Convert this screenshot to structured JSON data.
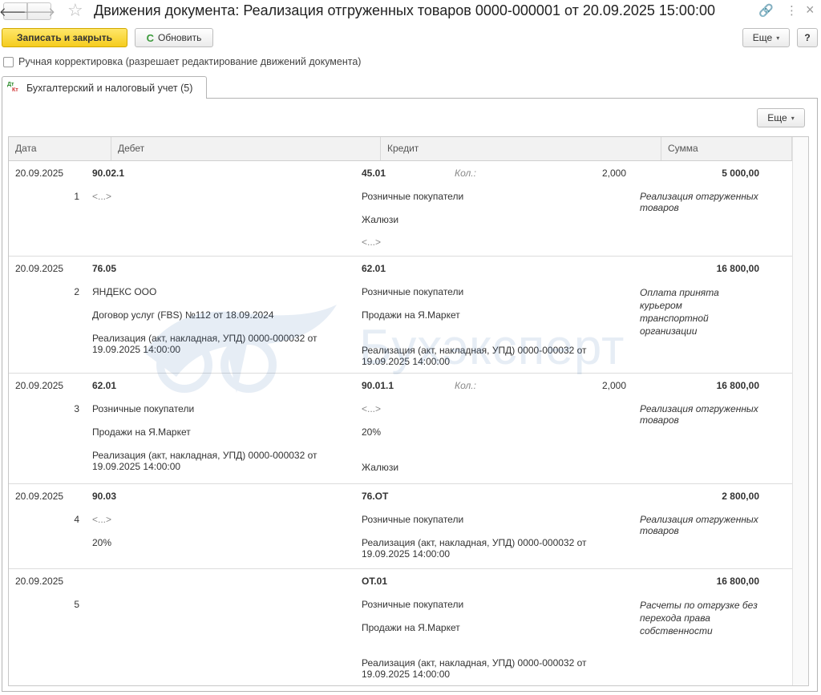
{
  "window": {
    "title": "Движения документа: Реализация отгруженных товаров 0000-000001 от 20.09.2025 15:00:00",
    "back_glyph": "🡐",
    "forward_glyph": "🡒",
    "star_glyph": "☆",
    "link_glyph": "🔗",
    "menu_glyph": "⋮",
    "close_glyph": "×",
    "icons": [
      "back-arrow-icon",
      "forward-arrow-icon",
      "star-icon",
      "link-icon",
      "more-vertical-icon",
      "close-icon"
    ]
  },
  "toolbar": {
    "save_close_label": "Записать и закрыть",
    "refresh_label": "Обновить",
    "refresh_glyph": "C",
    "more_label": "Еще",
    "caret_glyph": "▾",
    "help_label": "?"
  },
  "manual_adjust": {
    "label": "Ручная корректировка (разрешает редактирование движений документа)",
    "checked": false
  },
  "tabs": [
    {
      "label": "Бухгалтерский и налоговый учет (5)",
      "icon_dt": "Дт",
      "icon_kt": "Кт",
      "active": true
    }
  ],
  "grid": {
    "more_label": "Еще",
    "columns": [
      "Дата",
      "Дебет",
      "Кредит",
      "Сумма"
    ],
    "rows": [
      {
        "date": "20.09.2025",
        "num": "1",
        "debit_account": "90.02.1",
        "debit_lines": [
          "<...>"
        ],
        "credit_account": "45.01",
        "credit_lines": [
          "Розничные покупатели",
          "Жалюзи",
          "<...>"
        ],
        "qty_label": "Кол.:",
        "qty": "2,000",
        "amount": "5 000,00",
        "content": "Реализация отгруженных товаров"
      },
      {
        "date": "20.09.2025",
        "num": "2",
        "debit_account": "76.05",
        "debit_lines": [
          "ЯНДЕКС ООО",
          "Договор услуг (FBS) №112 от 18.09.2024",
          "Реализация (акт, накладная, УПД) 0000-000032 от 19.09.2025 14:00:00"
        ],
        "credit_account": "62.01",
        "credit_lines": [
          "Розничные покупатели",
          "Продажи на Я.Маркет",
          "Реализация (акт, накладная, УПД) 0000-000032 от 19.09.2025 14:00:00"
        ],
        "amount": "16 800,00",
        "content": "Оплата принята курьером транспортной организации"
      },
      {
        "date": "20.09.2025",
        "num": "3",
        "debit_account": "62.01",
        "debit_lines": [
          "Розничные покупатели",
          "Продажи на Я.Маркет",
          "Реализация (акт, накладная, УПД) 0000-000032 от 19.09.2025 14:00:00"
        ],
        "credit_account": "90.01.1",
        "credit_lines": [
          "<...>",
          "20%",
          "Жалюзи"
        ],
        "qty_label": "Кол.:",
        "qty": "2,000",
        "amount": "16 800,00",
        "content": "Реализация отгруженных товаров"
      },
      {
        "date": "20.09.2025",
        "num": "4",
        "debit_account": "90.03",
        "debit_lines": [
          "<...>",
          "20%"
        ],
        "credit_account": "76.ОТ",
        "credit_lines": [
          "Розничные покупатели",
          "Реализация (акт, накладная, УПД) 0000-000032 от 19.09.2025 14:00:00"
        ],
        "amount": "2 800,00",
        "content": "Реализация отгруженных товаров"
      },
      {
        "date": "20.09.2025",
        "num": "5",
        "debit_account": "",
        "debit_lines": [],
        "credit_account": "ОТ.01",
        "credit_lines": [
          "Розничные покупатели",
          "Продажи на Я.Маркет",
          "Реализация (акт, накладная, УПД) 0000-000032 от 19.09.2025 14:00:00"
        ],
        "amount": "16 800,00",
        "content": "Расчеты по отгрузке без перехода права собственности"
      }
    ]
  },
  "watermark": {
    "text": "Бухэксперт"
  }
}
